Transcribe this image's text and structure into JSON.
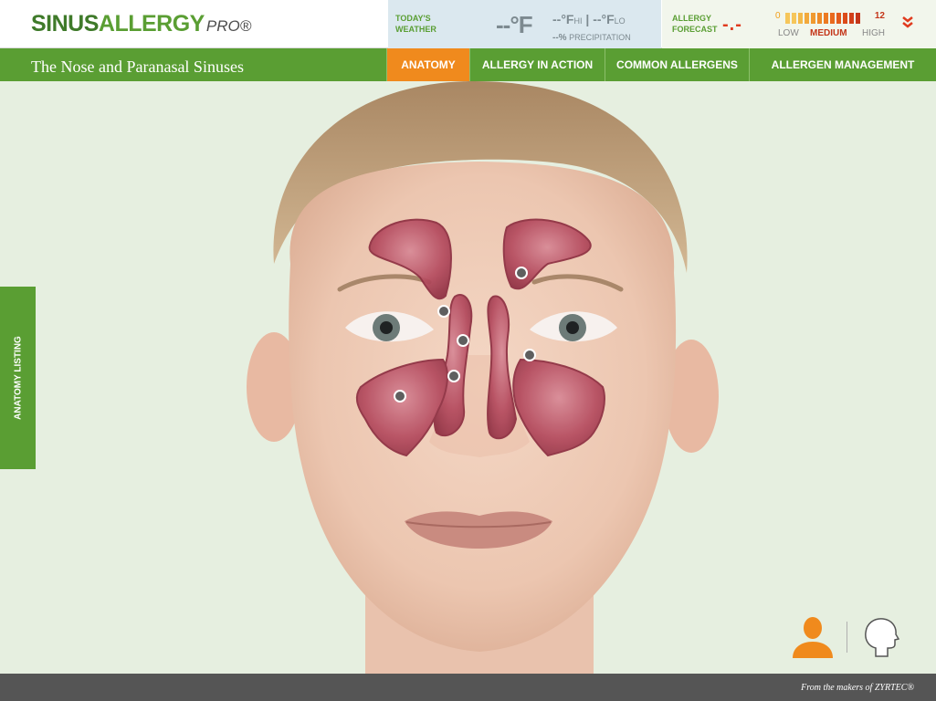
{
  "logo": {
    "part1": "SINUS",
    "part2": "ALLERGY",
    "part3": "PRO®"
  },
  "weather": {
    "label": "TODAY'S WEATHER",
    "temp": "--°F",
    "hi": "--°F",
    "hi_label": "HI",
    "lo": "--°F",
    "lo_label": "LO",
    "precip_value": "--%",
    "precip_label": "PRECIPITATION"
  },
  "forecast": {
    "label": "ALLERGY FORECAST",
    "value": "-.-",
    "scale_min": "0",
    "scale_max": "12",
    "low_label": "LOW",
    "medium_label": "MEDIUM",
    "high_label": "HIGH",
    "bar_colors": [
      "#f6c65a",
      "#f6c65a",
      "#f3b94a",
      "#f2a93c",
      "#f09a30",
      "#ee8a28",
      "#ec7a22",
      "#e96a1e",
      "#e35a1c",
      "#dc4b1a",
      "#d23f19",
      "#c4361a"
    ],
    "expand_icon": "double-chevron-down-icon"
  },
  "nav": {
    "page_title": "The Nose and Paranasal Sinuses",
    "tabs": [
      {
        "label": "ANATOMY",
        "active": true
      },
      {
        "label": "ALLERGY IN ACTION",
        "active": false
      },
      {
        "label": "COMMON ALLERGENS",
        "active": false
      },
      {
        "label": "ALLERGEN MANAGEMENT",
        "active": false
      }
    ]
  },
  "sidebar": {
    "anatomy_listing": "ANATOMY LISTING"
  },
  "views": {
    "front_icon": "head-front-icon",
    "side_icon": "head-profile-icon"
  },
  "footer": {
    "tagline": "From the makers of ZYRTEC®"
  },
  "colors": {
    "brand_green": "#5a9e33",
    "accent_orange": "#f08a1d",
    "forecast_red": "#e03a1e",
    "footer_gray": "#555555"
  }
}
